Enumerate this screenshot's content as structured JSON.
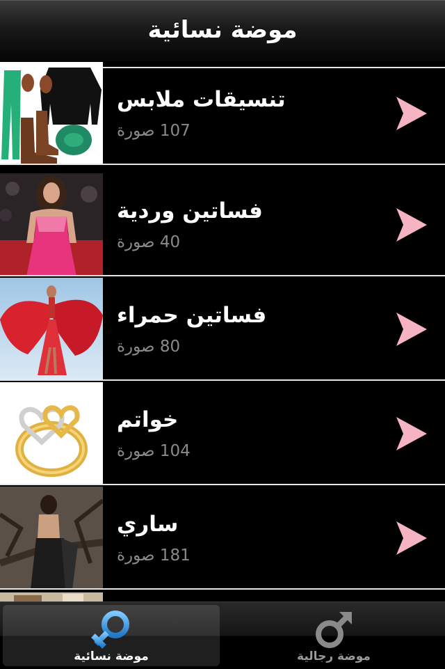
{
  "navbar": {
    "title": "موضة نسائية"
  },
  "list": {
    "items": [
      {
        "title": "تنسيقات ملابس",
        "count": "107 صورة",
        "thumb_icon": "outfit-collage-thumbnail"
      },
      {
        "title": "فساتين وردية",
        "count": "40 صورة",
        "thumb_icon": "pink-dress-thumbnail"
      },
      {
        "title": "فساتين حمراء",
        "count": "80 صورة",
        "thumb_icon": "red-dress-thumbnail"
      },
      {
        "title": "خواتم",
        "count": "104 صورة",
        "thumb_icon": "ring-thumbnail"
      },
      {
        "title": "ساري",
        "count": "181 صورة",
        "thumb_icon": "saree-thumbnail"
      }
    ],
    "chevron_color": "#f6b3c2"
  },
  "tabbar": {
    "tabs": [
      {
        "label": "موضة نسائية",
        "icon": "female-symbol-icon",
        "selected": true
      },
      {
        "label": "موضة رجالية",
        "icon": "male-symbol-icon",
        "selected": false
      }
    ],
    "accent": "#2b8fd8"
  }
}
